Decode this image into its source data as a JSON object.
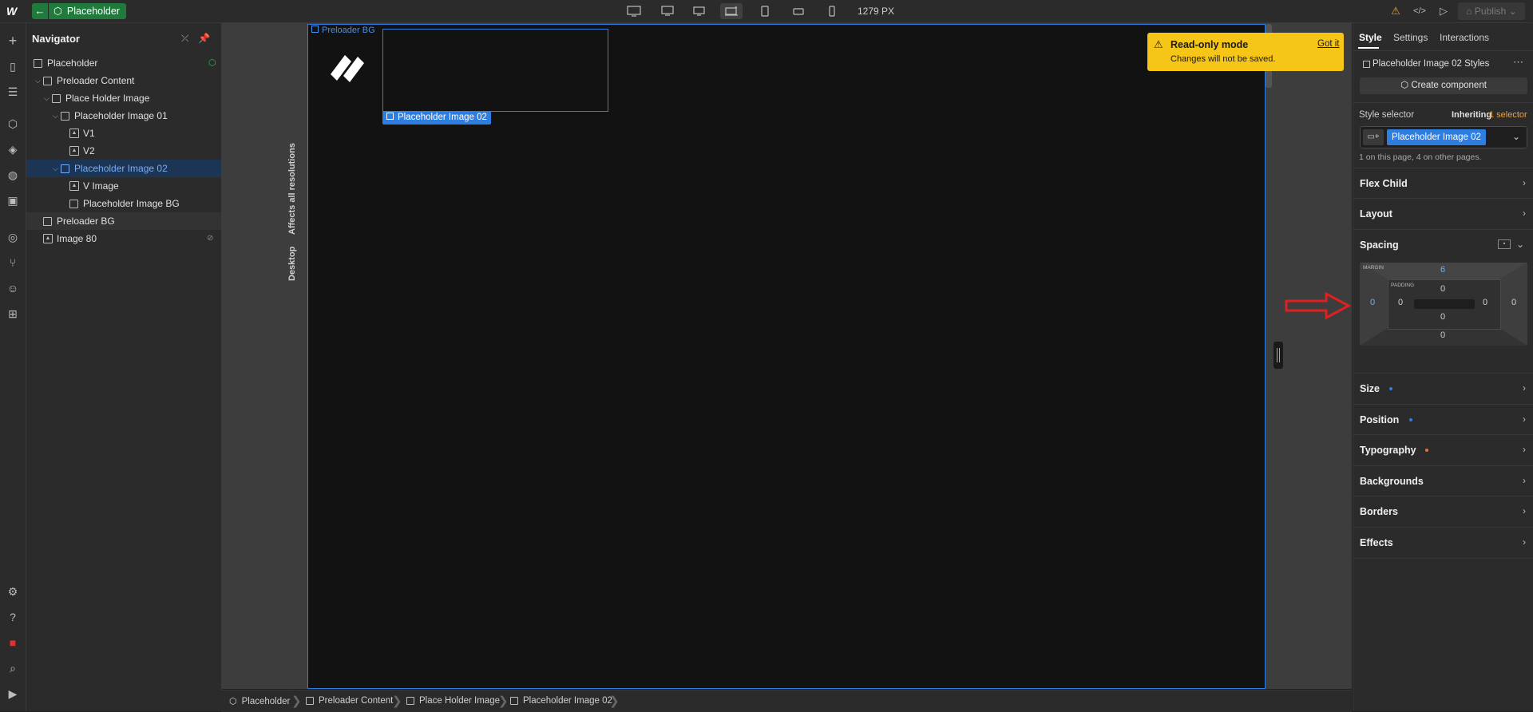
{
  "topbar": {
    "logo": "W",
    "back_icon": "←",
    "page_name": "Placeholder",
    "width_readout": "1279 PX",
    "publish_label": "Publish",
    "breakpoints": [
      "desktop-large-icon",
      "desktop-medium-icon",
      "desktop-icon",
      "desktop-base-icon",
      "tablet-icon",
      "mobile-landscape-icon",
      "mobile-portrait-icon"
    ]
  },
  "navigator": {
    "title": "Navigator",
    "items": [
      {
        "label": "Placeholder"
      },
      {
        "label": "Preloader Content"
      },
      {
        "label": "Place Holder Image"
      },
      {
        "label": "Placeholder Image 01"
      },
      {
        "label": "V1"
      },
      {
        "label": "V2"
      },
      {
        "label": "Placeholder Image 02"
      },
      {
        "label": "V Image"
      },
      {
        "label": "Placeholder Image BG"
      },
      {
        "label": "Preloader BG"
      },
      {
        "label": "Image 80"
      }
    ]
  },
  "canvas": {
    "preloader_bg_label": "Preloader BG",
    "selected_tag": "Placeholder Image 02",
    "affects_label": "Affects all resolutions",
    "desktop_label": "Desktop"
  },
  "readonly": {
    "title": "Read-only mode",
    "message": "Changes will not be saved.",
    "got_it": "Got it"
  },
  "breadcrumb": [
    "Placeholder",
    "Preloader Content",
    "Place Holder Image",
    "Placeholder Image 02"
  ],
  "panel": {
    "tabs": [
      "Style",
      "Settings",
      "Interactions"
    ],
    "styles_header": "Placeholder Image 02 Styles",
    "create_component": "Create component",
    "style_selector_label": "Style selector",
    "inheriting_label": "Inheriting",
    "inheriting_count": "1 selector",
    "selector_chip": "Placeholder Image 02",
    "selector_note": "1 on this page, 4 on other pages.",
    "sections": [
      "Flex Child",
      "Layout",
      "Spacing",
      "Size",
      "Position",
      "Typography",
      "Backgrounds",
      "Borders",
      "Effects"
    ],
    "spacing": {
      "margin_label": "MARGIN",
      "padding_label": "PADDING",
      "margin_top": "6",
      "margin_left": "0",
      "margin_right": "0",
      "margin_bottom": "0",
      "padding_top": "0",
      "padding_left": "0",
      "padding_right": "0",
      "padding_bottom": "0"
    }
  },
  "colors": {
    "accent": "#2e7de0",
    "brand_green": "#1f7a3c",
    "warning": "#f5c518",
    "annotation_red": "#e02020"
  }
}
